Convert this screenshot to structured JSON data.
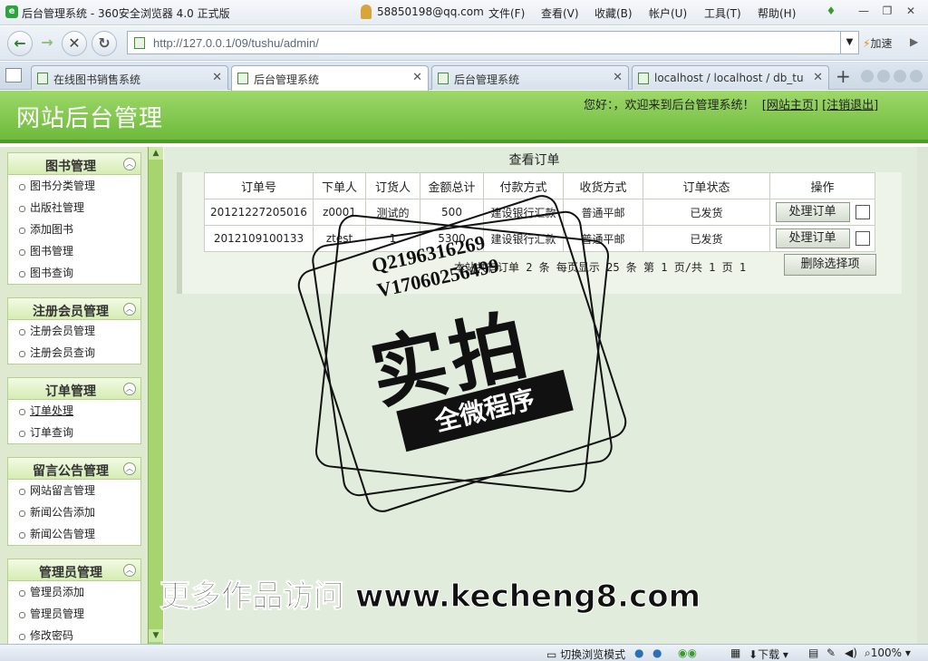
{
  "browser": {
    "title": "后台管理系统 - 360安全浏览器 4.0 正式版",
    "user_email": "58850198@qq.com",
    "menus": [
      "文件(F)",
      "查看(V)",
      "收藏(B)",
      "帐户(U)",
      "工具(T)",
      "帮助(H)"
    ],
    "url": "http://127.0.0.1/09/tushu/admin/",
    "speed_label": "加速",
    "tabs": [
      {
        "label": "在线图书销售系统"
      },
      {
        "label": "后台管理系统"
      },
      {
        "label": "后台管理系统"
      },
      {
        "label": "localhost / localhost / db_tu..."
      }
    ],
    "status": {
      "mode": "切换浏览模式",
      "download": "下载",
      "zoom": "100%"
    }
  },
  "site": {
    "title": "网站后台管理",
    "welcome": "您好：，欢迎来到后台管理系统！",
    "home_link": "网站主页",
    "logout_link": "注销退出"
  },
  "sidebar": {
    "sections": [
      {
        "title": "图书管理",
        "items": [
          "图书分类管理",
          "出版社管理",
          "添加图书",
          "图书管理",
          "图书查询"
        ]
      },
      {
        "title": "注册会员管理",
        "items": [
          "注册会员管理",
          "注册会员查询"
        ]
      },
      {
        "title": "订单管理",
        "items": [
          "订单处理",
          "订单查询"
        ]
      },
      {
        "title": "留言公告管理",
        "items": [
          "网站留言管理",
          "新闻公告添加",
          "新闻公告管理"
        ]
      },
      {
        "title": "管理员管理",
        "items": [
          "管理员添加",
          "管理员管理",
          "修改密码"
        ]
      }
    ]
  },
  "main": {
    "title": "查看订单",
    "columns": [
      "订单号",
      "下单人",
      "订货人",
      "金额总计",
      "付款方式",
      "收货方式",
      "订单状态",
      "操作"
    ],
    "rows": [
      {
        "order_no": "20121227205016",
        "orderer": "z0001",
        "receiver": "测试的",
        "amount": "500",
        "payment": "建设银行汇款",
        "shipping": "普通平邮",
        "status": "已发货",
        "action": "处理订单"
      },
      {
        "order_no": "2012109100133",
        "orderer": "ztest",
        "receiver": "1",
        "amount": "5300",
        "payment": "建设银行汇款",
        "shipping": "普通平邮",
        "status": "已发货",
        "action": "处理订单"
      }
    ],
    "pager": "本站共有订单 2 条 每页显示 25 条 第 1 页/共 1 页 1",
    "delete_label": "删除选择项"
  },
  "watermark": {
    "qq": "Q2196316269",
    "v": "V17060256499",
    "big": "实拍",
    "ribbon": "全微程序",
    "banner": "更多作品访问 www.kecheng8.com"
  }
}
